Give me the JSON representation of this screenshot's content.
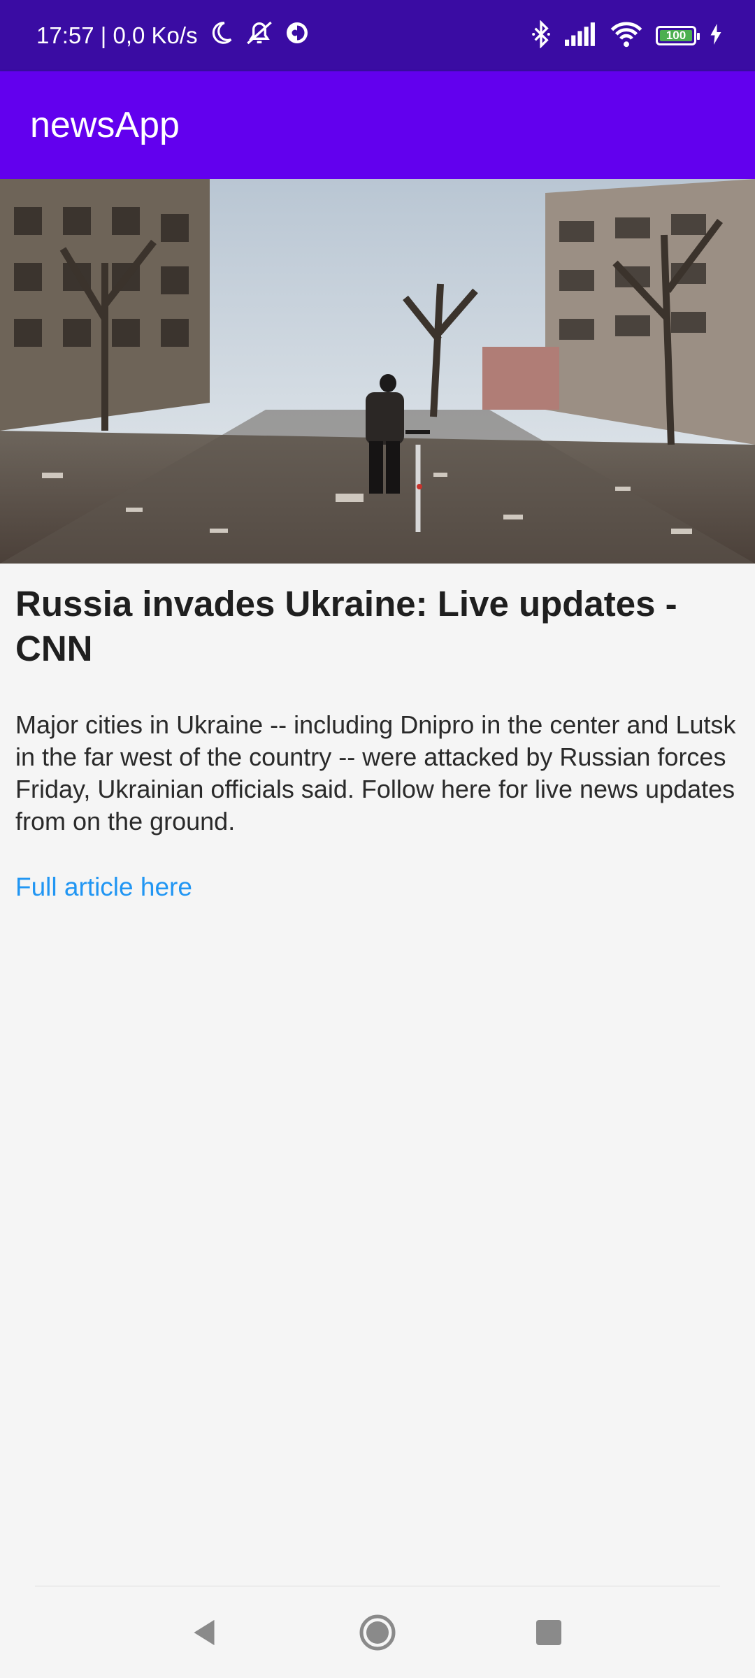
{
  "status_bar": {
    "time_speed": "17:57 | 0,0 Ko/s",
    "battery_level": "100",
    "battery_fraction": 1.0,
    "icons": [
      "moon-icon",
      "alarm-off-icon",
      "data-saver-icon",
      "bluetooth-icon",
      "signal-icon",
      "wifi-icon",
      "battery-icon",
      "charging-icon"
    ]
  },
  "app_bar": {
    "title": "newsApp"
  },
  "article": {
    "image_alt": "photo",
    "title": "Russia invades Ukraine: Live updates - CNN",
    "description": "Major cities in Ukraine -- including Dnipro in the center and Lutsk in the far west of the country -- were attacked by Russian forces Friday, Ukrainian officials said. Follow here for live news updates from on the ground.",
    "link_label": "Full article here"
  },
  "nav_bar": {
    "buttons": [
      "back-icon",
      "home-icon",
      "recents-icon"
    ]
  },
  "colors": {
    "status_bar": "#3a0ca3",
    "app_bar": "#6200ee",
    "link": "#2196f3",
    "background": "#f5f5f5"
  }
}
